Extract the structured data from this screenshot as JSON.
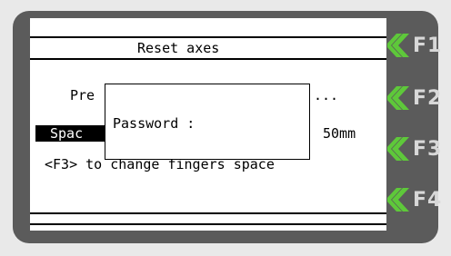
{
  "screen": {
    "title": "Reset axes",
    "row1_prefix": "Pre",
    "row1_suffix": "...",
    "space_label": "Spac",
    "space_value": "50mm",
    "f3_hint": "<F3> to change fingers space"
  },
  "dialog": {
    "label": "Password :"
  },
  "function_keys": [
    {
      "label": "F1"
    },
    {
      "label": "F2"
    },
    {
      "label": "F3"
    },
    {
      "label": "F4"
    }
  ],
  "colors": {
    "bezel": "#5b5b5b",
    "screen": "#ffffff",
    "accent_green": "#5ec83a",
    "key_text": "#d8d8d8"
  }
}
